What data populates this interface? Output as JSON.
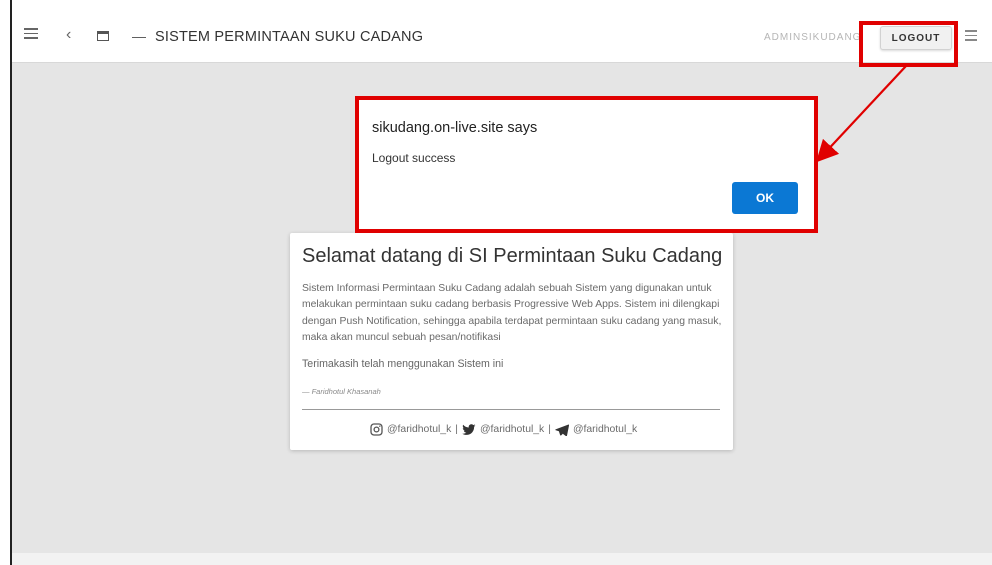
{
  "topbar": {
    "title": "SISTEM PERMINTAAN SUKU CADANG",
    "user": "ADMINSIKUDANG",
    "logout_label": "LOGOUT"
  },
  "icons": {
    "menu_left": "hamburger-menu-icon",
    "back": "chevron-left-icon",
    "window": "window-icon",
    "menu_right": "hamburger-menu-icon"
  },
  "dialog": {
    "title": "sikudang.on-live.site says",
    "message": "Logout success",
    "ok_label": "OK"
  },
  "card": {
    "title": "Selamat datang di SI Permintaan Suku Cadang",
    "description": "Sistem Informasi Permintaan Suku Cadang adalah sebuah Sistem yang digunakan untuk melakukan permintaan suku cadang berbasis Progressive Web Apps. Sistem ini dilengkapi dengan Push Notification, sehingga apabila terdapat permintaan suku cadang yang masuk, maka akan muncul sebuah pesan/notifikasi",
    "thanks": "Terimakasih telah menggunakan Sistem ini",
    "author": "— Faridhotul Khasanah",
    "social": [
      {
        "icon": "instagram-icon",
        "handle": "@faridhotul_k"
      },
      {
        "icon": "twitter-icon",
        "handle": "@faridhotul_k"
      },
      {
        "icon": "telegram-icon",
        "handle": "@faridhotul_k"
      }
    ],
    "separator": "|"
  },
  "colors": {
    "highlight": "#e00000",
    "ok_button": "#0b78d4",
    "background": "#e5e5e5"
  }
}
